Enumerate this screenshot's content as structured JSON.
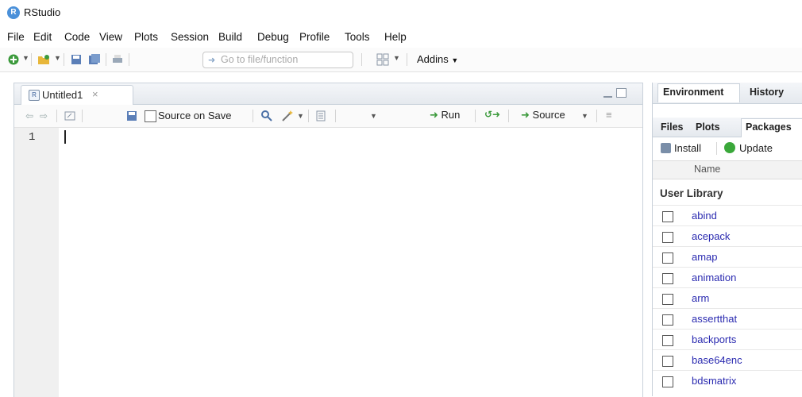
{
  "window": {
    "title": "RStudio",
    "logo_letter": "R"
  },
  "menu": [
    "File",
    "Edit",
    "Code",
    "View",
    "Plots",
    "Session",
    "Build",
    "Debug",
    "Profile",
    "Tools",
    "Help"
  ],
  "toolbar": {
    "goto_placeholder": "Go to file/function",
    "addins_label": "Addins"
  },
  "editor": {
    "tab_name": "Untitled1",
    "source_on_save_label": "Source on Save",
    "source_on_save_checked": false,
    "run_label": "Run",
    "source_label": "Source",
    "line_numbers": [
      "1"
    ]
  },
  "right_top_tabs": [
    "Environment",
    "History"
  ],
  "right_bottom_tabs": [
    "Files",
    "Plots",
    "Packages"
  ],
  "active_bottom_tab": "Packages",
  "packages": {
    "install_label": "Install",
    "update_label": "Update",
    "column_name": "Name",
    "library_label": "User Library",
    "items": [
      "abind",
      "acepack",
      "amap",
      "animation",
      "arm",
      "assertthat",
      "backports",
      "base64enc",
      "bdsmatrix"
    ]
  },
  "colors": {
    "accent": "#4a90d9",
    "link": "#2a2ab0",
    "update_green": "#3aa83a"
  }
}
